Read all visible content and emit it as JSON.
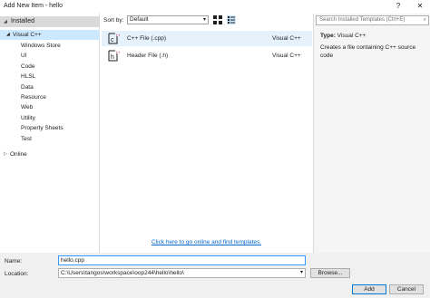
{
  "window": {
    "title": "Add New Item - hello",
    "help_glyph": "?",
    "close_glyph": "✕"
  },
  "sidebar": {
    "installed_label": "Installed",
    "visual_cpp_label": "Visual C++",
    "items": [
      {
        "label": "Windows Store"
      },
      {
        "label": "UI"
      },
      {
        "label": "Code"
      },
      {
        "label": "HLSL"
      },
      {
        "label": "Data"
      },
      {
        "label": "Resource"
      },
      {
        "label": "Web"
      },
      {
        "label": "Utility"
      },
      {
        "label": "Property Sheets"
      },
      {
        "label": "Test"
      }
    ],
    "online_label": "Online"
  },
  "toolbar": {
    "sort_by_label": "Sort by:",
    "sort_by_value": "Default"
  },
  "templates": [
    {
      "name": "C++ File (.cpp)",
      "language": "Visual C++",
      "icon": "cpp-file-icon"
    },
    {
      "name": "Header File (.h)",
      "language": "Visual C++",
      "icon": "header-file-icon"
    }
  ],
  "online_link": "Click here to go online and find templates.",
  "details": {
    "search_placeholder": "Search Installed Templates (Ctrl+E)",
    "type_label": "Type:",
    "type_value": "Visual C++",
    "description": "Creates a file containing C++ source code"
  },
  "form": {
    "name_label": "Name:",
    "name_value": "hello.cpp",
    "location_label": "Location:",
    "location_value": "C:\\Users\\tangos\\workspace\\oop244\\hello\\hello\\",
    "browse_label": "Browse...",
    "add_label": "Add",
    "cancel_label": "Cancel"
  },
  "colors": {
    "accent": "#0078d7",
    "selection": "#cce8ff",
    "link": "#0066cc",
    "icon_pink": "#c2185b"
  }
}
